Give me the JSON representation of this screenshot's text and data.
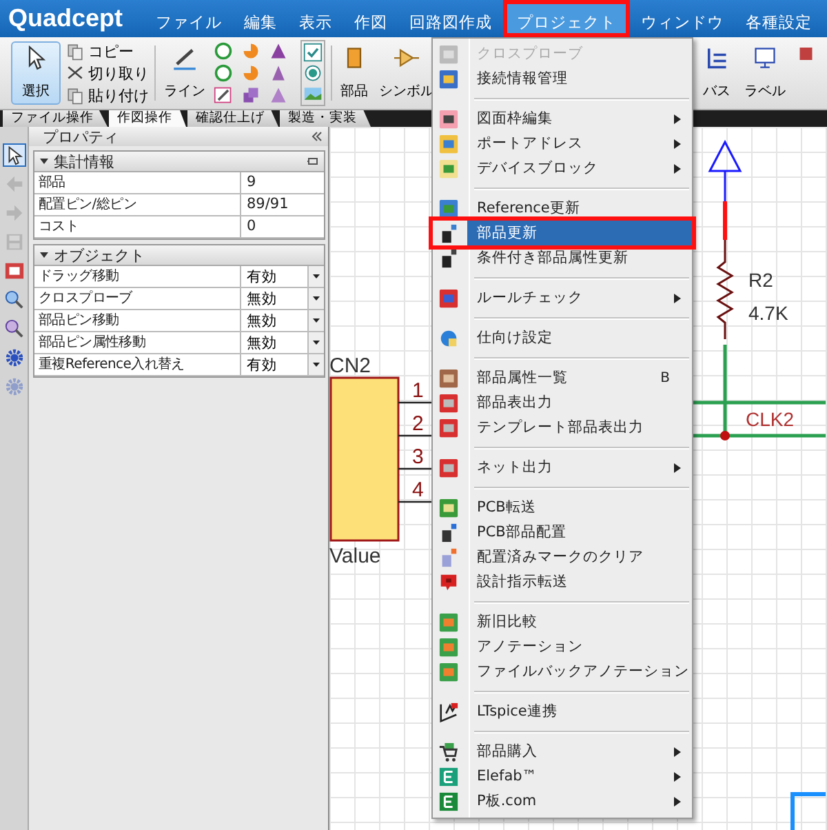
{
  "menubar": {
    "logo": "Quadcept",
    "items": [
      {
        "label": "ファイル",
        "selected": false
      },
      {
        "label": "編集",
        "selected": false
      },
      {
        "label": "表示",
        "selected": false
      },
      {
        "label": "作図",
        "selected": false
      },
      {
        "label": "回路図作成",
        "selected": false
      },
      {
        "label": "プロジェクト",
        "selected": true
      },
      {
        "label": "ウィンドウ",
        "selected": false
      },
      {
        "label": "各種設定",
        "selected": false
      }
    ]
  },
  "toolbar": {
    "select_button": {
      "label": "選択",
      "selected": true
    },
    "edit_actions": [
      {
        "label": "コピー"
      },
      {
        "label": "切り取り"
      },
      {
        "label": "貼り付け"
      }
    ],
    "tools": [
      {
        "label": "ライン"
      },
      {
        "label": "部品"
      },
      {
        "label": "シンボル"
      },
      {
        "label": "バス"
      },
      {
        "label": "ラベル"
      }
    ]
  },
  "ribbon_tabs": [
    {
      "label": "ファイル操作",
      "selected": false
    },
    {
      "label": "作図操作",
      "selected": true
    },
    {
      "label": "確認仕上げ",
      "selected": false
    },
    {
      "label": "製造・実装",
      "selected": false
    }
  ],
  "left_tools": [
    {
      "kind": "pointer",
      "selected": true,
      "disabled": false
    },
    {
      "kind": "back",
      "selected": false,
      "disabled": true
    },
    {
      "kind": "forward",
      "selected": false,
      "disabled": true
    },
    {
      "kind": "save",
      "selected": false,
      "disabled": true
    },
    {
      "kind": "fit",
      "selected": false,
      "disabled": false
    },
    {
      "kind": "zoom_in",
      "selected": false,
      "disabled": false
    },
    {
      "kind": "zoom_out",
      "selected": false,
      "disabled": false
    },
    {
      "kind": "gear",
      "selected": false,
      "disabled": false
    },
    {
      "kind": "gear",
      "selected": false,
      "disabled": true
    }
  ],
  "properties": {
    "title": "プロパティ",
    "sections": [
      {
        "title": "集計情報",
        "expanded": true,
        "pinned": true,
        "rows": [
          {
            "name": "部品",
            "value": "9",
            "kind": "text"
          },
          {
            "name": "配置ピン/総ピン",
            "value": "89/91",
            "kind": "text"
          },
          {
            "name": "コスト",
            "value": "0",
            "kind": "text"
          }
        ]
      },
      {
        "title": "オブジェクト",
        "expanded": true,
        "pinned": false,
        "rows": [
          {
            "name": "ドラッグ移動",
            "value": "有効",
            "kind": "dropdown"
          },
          {
            "name": "クロスプローブ",
            "value": "無効",
            "kind": "dropdown"
          },
          {
            "name": "部品ピン移動",
            "value": "無効",
            "kind": "dropdown"
          },
          {
            "name": "部品ピン属性移動",
            "value": "無効",
            "kind": "dropdown"
          },
          {
            "name": "重複Reference入れ替え",
            "value": "有効",
            "kind": "dropdown"
          }
        ]
      }
    ]
  },
  "schematic": {
    "component": {
      "reference": "CN2",
      "value": "Value",
      "pins": [
        "1",
        "2",
        "3",
        "4"
      ]
    },
    "resistor": {
      "reference": "R2",
      "value": "4.7K"
    },
    "net_label": "CLK2"
  },
  "menu": {
    "items": [
      {
        "kind": "item",
        "label": "クロスプローブ",
        "disabled": true,
        "selected": false,
        "submenu": false
      },
      {
        "kind": "item",
        "label": "接続情報管理",
        "disabled": false,
        "selected": false,
        "submenu": false
      },
      {
        "kind": "separator"
      },
      {
        "kind": "item",
        "label": "図面枠編集",
        "disabled": false,
        "selected": false,
        "submenu": true
      },
      {
        "kind": "item",
        "label": "ポートアドレス",
        "disabled": false,
        "selected": false,
        "submenu": true
      },
      {
        "kind": "item",
        "label": "デバイスブロック",
        "disabled": false,
        "selected": false,
        "submenu": true
      },
      {
        "kind": "separator"
      },
      {
        "kind": "item",
        "label": "Reference更新",
        "disabled": false,
        "selected": false,
        "submenu": false
      },
      {
        "kind": "item",
        "label": "部品更新",
        "disabled": false,
        "selected": true,
        "submenu": false
      },
      {
        "kind": "item",
        "label": "条件付き部品属性更新",
        "disabled": false,
        "selected": false,
        "submenu": false
      },
      {
        "kind": "separator"
      },
      {
        "kind": "item",
        "label": "ルールチェック",
        "disabled": false,
        "selected": false,
        "submenu": true
      },
      {
        "kind": "separator"
      },
      {
        "kind": "item",
        "label": "仕向け設定",
        "disabled": false,
        "selected": false,
        "submenu": false
      },
      {
        "kind": "separator"
      },
      {
        "kind": "item",
        "label": "部品属性一覧",
        "disabled": false,
        "selected": false,
        "submenu": false,
        "shortcut": "B"
      },
      {
        "kind": "item",
        "label": "部品表出力",
        "disabled": false,
        "selected": false,
        "submenu": false
      },
      {
        "kind": "item",
        "label": "テンプレート部品表出力",
        "disabled": false,
        "selected": false,
        "submenu": false
      },
      {
        "kind": "separator"
      },
      {
        "kind": "item",
        "label": "ネット出力",
        "disabled": false,
        "selected": false,
        "submenu": true
      },
      {
        "kind": "separator"
      },
      {
        "kind": "item",
        "label": "PCB転送",
        "disabled": false,
        "selected": false,
        "submenu": false
      },
      {
        "kind": "item",
        "label": "PCB部品配置",
        "disabled": false,
        "selected": false,
        "submenu": false
      },
      {
        "kind": "item",
        "label": "配置済みマークのクリア",
        "disabled": false,
        "selected": false,
        "submenu": false
      },
      {
        "kind": "item",
        "label": "設計指示転送",
        "disabled": false,
        "selected": false,
        "submenu": false
      },
      {
        "kind": "separator"
      },
      {
        "kind": "item",
        "label": "新旧比較",
        "disabled": false,
        "selected": false,
        "submenu": false
      },
      {
        "kind": "item",
        "label": "アノテーション",
        "disabled": false,
        "selected": false,
        "submenu": false
      },
      {
        "kind": "item",
        "label": "ファイルバックアノテーション",
        "disabled": false,
        "selected": false,
        "submenu": false
      },
      {
        "kind": "separator"
      },
      {
        "kind": "item",
        "label": "LTspice連携",
        "disabled": false,
        "selected": false,
        "submenu": false
      },
      {
        "kind": "separator"
      },
      {
        "kind": "item",
        "label": "部品購入",
        "disabled": false,
        "selected": false,
        "submenu": true
      },
      {
        "kind": "item",
        "label": "Elefab™",
        "disabled": false,
        "selected": false,
        "submenu": true
      },
      {
        "kind": "item",
        "label": "P板.com",
        "disabled": false,
        "selected": false,
        "submenu": true
      }
    ]
  }
}
